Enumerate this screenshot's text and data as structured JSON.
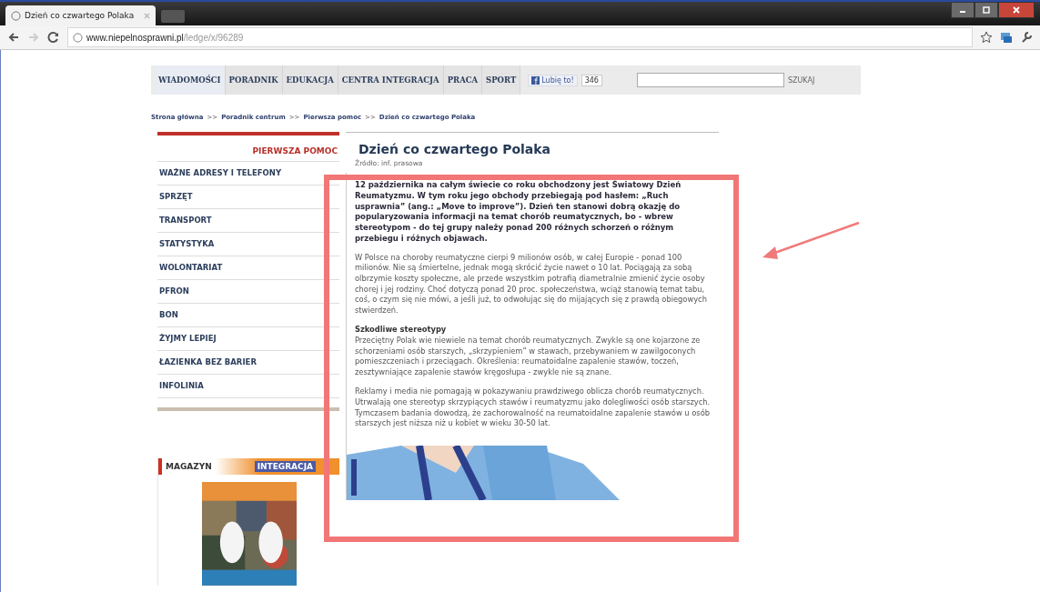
{
  "browser": {
    "tab_title": "Dzień co czwartego Polaka",
    "url_domain": "www.niepelnosprawni.pl",
    "url_path": "/ledge/x/96289"
  },
  "nav": {
    "items": [
      {
        "label": "WIADOMOŚCI",
        "selected": true
      },
      {
        "label": "PORADNIK",
        "selected": false
      },
      {
        "label": "EDUKACJA",
        "selected": false
      },
      {
        "label": "CENTRA INTEGRACJA",
        "selected": false
      },
      {
        "label": "PRACA",
        "selected": false
      },
      {
        "label": "SPORT",
        "selected": false
      }
    ],
    "like_label": "Lubię to!",
    "like_count": "346",
    "search_button": "SZUKAJ"
  },
  "breadcrumb": [
    "Strona główna",
    ">>",
    "Poradnik centrum",
    ">>",
    "Pierwsza pomoc",
    ">>",
    "Dzień co czwartego Polaka"
  ],
  "sidebar": {
    "heading": "PIERWSZA POMOC",
    "items": [
      "WAŻNE ADRESY I TELEFONY",
      "SPRZĘT",
      "TRANSPORT",
      "STATYSTYKA",
      "WOLONTARIAT",
      "PFRON",
      "BON",
      "ŻYJMY LEPIEJ",
      "ŁAZIENKA BEZ BARIER",
      "INFOLINIA"
    ]
  },
  "magazine": {
    "title": "MAGAZYN",
    "logo": "INTEGRACJA"
  },
  "article": {
    "title": "Dzień co czwartego Polaka",
    "source": "Źródło: inf. prasowa",
    "sections": [
      {
        "kind": "lead",
        "text": "12 października na całym świecie co roku obchodzony jest Światowy Dzień Reumatyzmu. W tym roku jego obchody przebiegają pod hasłem: „Ruch usprawnia” (ang.: „Move to improve”). Dzień ten stanowi dobrą okazję do popularyzowania informacji na temat chorób reumatycznych, bo - wbrew stereotypom - do tej grupy należy ponad 200 różnych schorzeń o różnym przebiegu i różnych objawach."
      },
      {
        "kind": "body",
        "text": "W Polsce na choroby reumatyczne cierpi 9 milionów osób, w całej Europie - ponad 100 milionów. Nie są śmiertelne, jednak mogą skrócić życie nawet o 10 lat. Pociągają za sobą olbrzymie koszty społeczne, ale przede wszystkim potrafią diametralnie zmienić życie osoby chorej i jej rodziny. Choć dotyczą ponad 20 proc. społeczeństwa, wciąż stanowią temat tabu, coś, o czym się nie mówi, a jeśli już, to odwołując się do mijających się z prawdą obiegowych stwierdzeń."
      },
      {
        "kind": "heading",
        "text": "Szkodliwe stereotypy"
      },
      {
        "kind": "body_tight",
        "text": "Przeciętny Polak wie niewiele na temat chorób reumatycznych. Zwykle są one kojarzone ze schorzeniami osób starszych, „skrzypieniem” w stawach, przebywaniem w zawilgoconych pomieszczeniach i przeciągach. Określenia: reumatoidalne zapalenie stawów, toczeń, zesztywniające zapalenie stawów kręgosłupa - zwykle nie są znane."
      },
      {
        "kind": "body",
        "text": "Reklamy i media nie pomagają w pokazywaniu prawdziwego oblicza chorób reumatycznych. Utrwalają one stereotyp skrzypiących stawów i reumatyzmu jako dolegliwości osób starszych. Tymczasem badania dowodzą, że zachorowalność na reumatoidalne zapalenie stawów u osób starszych jest niższa niż u kobiet w wieku 30-50 lat."
      }
    ]
  }
}
